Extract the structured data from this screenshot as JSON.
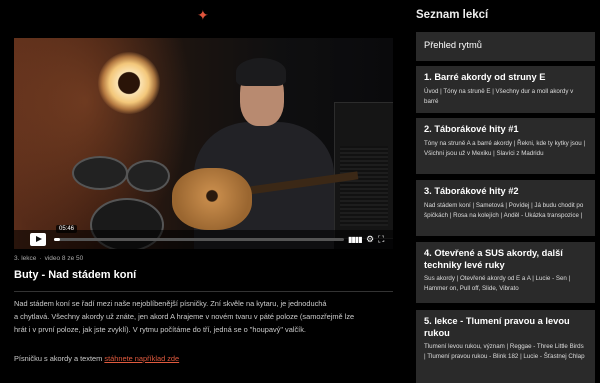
{
  "logo": "✦",
  "player": {
    "duration": "05:46",
    "progress": 0.02
  },
  "meta": {
    "lesson": "3. lekce",
    "video_index": "video 8 ze 50"
  },
  "video_title": "Buty - Nad stádem koní",
  "description": {
    "line1": "Nad stádem koní se řadí mezi naše nejoblíbenější písničky. Zní skvěle na kytaru, je jednoduchá",
    "line2": "a chytlavá. Všechny akordy už znáte, jen akord A hrajeme v novém tvaru v páté poloze (samozřejmě lze",
    "line3": "hrát i v první poloze, jak jste zvyklí). V rytmu počítáme do tří, jedná se o \"houpavý\" valčík.",
    "link_prefix": "Písničku s akordy a textem",
    "link_text": "stáhnete například zde"
  },
  "sidebar": {
    "title": "Seznam lekcí",
    "cards": [
      {
        "title": "Přehled rytmů",
        "subtitle": ""
      },
      {
        "title": "1. Barré akordy od struny E",
        "subtitle": "Úvod | Tóny na struně E | Všechny dur a moll akordy v barré"
      },
      {
        "title": "2. Táborákové hity #1",
        "subtitle": "Tóny na struně A a barré akordy | Řekni, kde ty kytky jsou | Všichni jsou už v Mexiku | Slavíci z Madridu"
      },
      {
        "title": "3. Táborákové hity #2",
        "subtitle": "Nad stádem koní | Sametová | Povídej | Já budu chodit po špičkách | Rosa na kolejích | Anděl - Ukázka transpozice |"
      },
      {
        "title": "4. Otevřené a SUS akordy, další techniky levé ruky",
        "subtitle": "Sus akordy | Otevřené akordy od E a A | Lucie - Sen | Hammer on, Pull off, Slide, Vibrato"
      },
      {
        "title": "5. lekce - Tlumení pravou a levou rukou",
        "subtitle": "Tlumení levou rukou, význam | Reggae - Three Little Birds | Tlumení pravou rukou - Blink 182 | Lucie - Šťastnej Chlap"
      }
    ]
  }
}
